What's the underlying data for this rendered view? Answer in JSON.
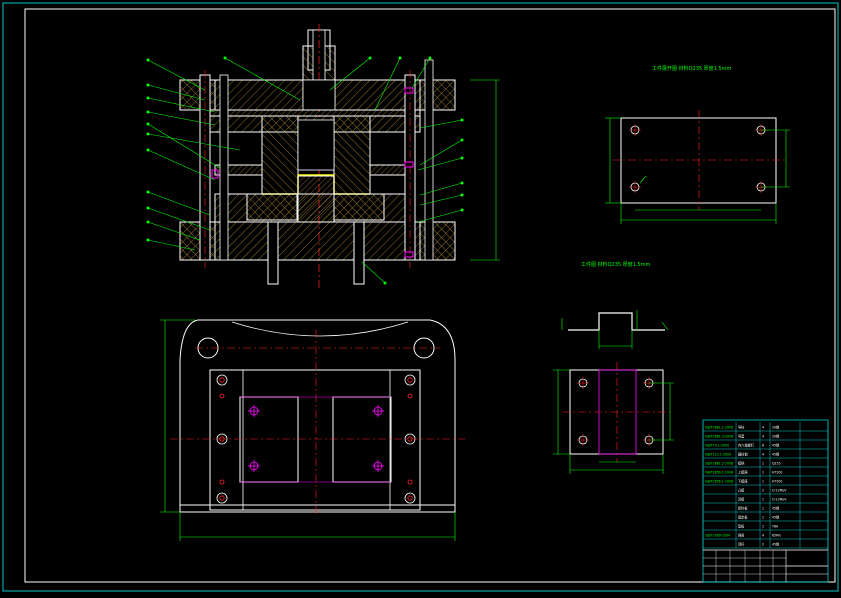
{
  "colors": {
    "background": "#000000",
    "frame": "#ffffff",
    "outline": "#ffffff",
    "hatch": "#c8a040",
    "centerline": "#ff2020",
    "dimension": "#00ff00",
    "title_block": "#00c8c8",
    "highlight": "#ffff00",
    "magenta": "#ff00ff",
    "note": "#00ff00"
  },
  "notes": {
    "part_drawing_1": "工件展开图 材料Q235 厚度1.5mm",
    "part_drawing_2": "工件图 材料Q235 厚度1.5mm"
  },
  "title_block": {
    "rows": [
      {
        "code": "GB/T2861.1-2008",
        "name": "导柱",
        "qty": "4",
        "material": "20钢"
      },
      {
        "code": "GB/T2861.3-2008",
        "name": "导套",
        "qty": "4",
        "material": "20钢"
      },
      {
        "code": "GB/T70.1-2000",
        "name": "内六角螺钉",
        "qty": "8",
        "material": "45钢"
      },
      {
        "code": "GB/T119.1-2000",
        "name": "圆柱销",
        "qty": "4",
        "material": "45钢"
      },
      {
        "code": "GB/T2861.5-2008",
        "name": "模柄",
        "qty": "1",
        "material": "Q235"
      },
      {
        "code": "GB/T2856.1-2008",
        "name": "上模座",
        "qty": "1",
        "material": "HT200"
      },
      {
        "code": "GB/T2856.1-2008",
        "name": "下模座",
        "qty": "1",
        "material": "HT200"
      },
      {
        "code": "",
        "name": "凸模",
        "qty": "2",
        "material": "Cr12MoV"
      },
      {
        "code": "",
        "name": "凹模",
        "qty": "1",
        "material": "Cr12MoV"
      },
      {
        "code": "",
        "name": "卸料板",
        "qty": "1",
        "material": "45钢"
      },
      {
        "code": "",
        "name": "固定板",
        "qty": "1",
        "material": "45钢"
      },
      {
        "code": "",
        "name": "垫板",
        "qty": "1",
        "material": "T8A"
      },
      {
        "code": "GB/T2089-1994",
        "name": "弹簧",
        "qty": "4",
        "material": "65Mn"
      },
      {
        "code": "",
        "name": "顶杆",
        "qty": "2",
        "material": "45钢"
      }
    ]
  }
}
